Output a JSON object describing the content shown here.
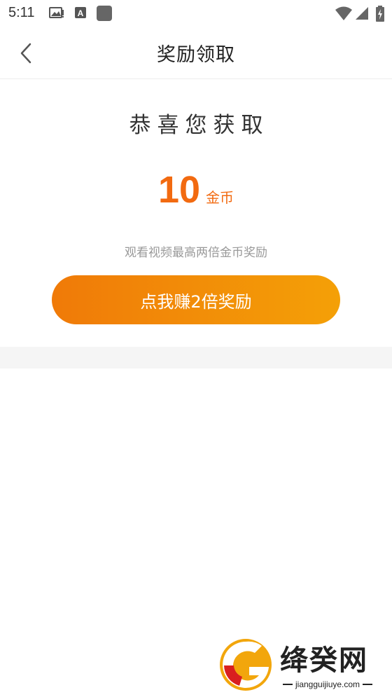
{
  "status_bar": {
    "time": "5:11"
  },
  "header": {
    "title": "奖励领取",
    "back_icon": "chevron-left-icon"
  },
  "content": {
    "congrats": "恭喜您获取",
    "reward_amount": "10",
    "reward_unit": "金币",
    "hint": "观看视频最高两倍金币奖励",
    "double_button_label": "点我赚2倍奖励"
  },
  "watermark": {
    "brand": "绛癸网",
    "url": "jiangguijiuye.com"
  },
  "colors": {
    "accent": "#f26a10",
    "button_start": "#f07a08",
    "button_end": "#f4a007",
    "hint": "#999999",
    "band": "#f5f5f5"
  }
}
